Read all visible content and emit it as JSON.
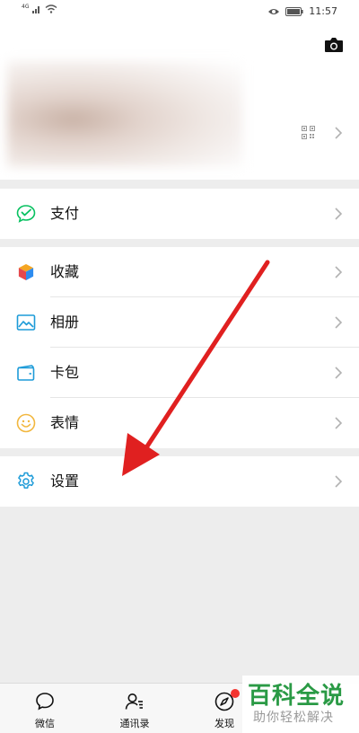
{
  "status_bar": {
    "signal_tag": "4G",
    "time": "11:57"
  },
  "menu": {
    "pay": {
      "label": "支付",
      "icon": "wechat-pay-icon",
      "color": "#07c160"
    },
    "favorites": {
      "label": "收藏",
      "icon": "favorites-cube-icon"
    },
    "album": {
      "label": "相册",
      "icon": "album-icon",
      "color": "#1d9bd8"
    },
    "cards": {
      "label": "卡包",
      "icon": "card-wallet-icon",
      "color": "#1d9bd8"
    },
    "stickers": {
      "label": "表情",
      "icon": "sticker-smiley-icon",
      "color": "#f2b73e"
    },
    "settings": {
      "label": "设置",
      "icon": "gear-icon",
      "color": "#1d9bd8"
    }
  },
  "bottom_nav": [
    {
      "label": "微信",
      "icon": "chat-bubble-icon"
    },
    {
      "label": "通讯录",
      "icon": "contacts-icon"
    },
    {
      "label": "发现",
      "icon": "compass-icon",
      "badge": true
    }
  ],
  "watermark": {
    "title": "百科全说",
    "subtitle": "助你轻松解决"
  },
  "annotation": {
    "arrow_color": "#e02020",
    "points_to": "settings"
  }
}
